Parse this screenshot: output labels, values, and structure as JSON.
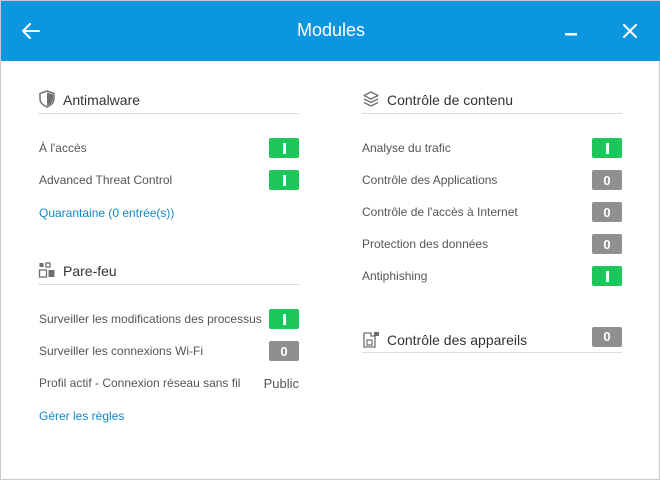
{
  "window": {
    "title": "Modules",
    "accent": "#0d96e0"
  },
  "colors": {
    "on": "#1ec55b",
    "off": "#8f8f8f",
    "link": "#1288c8"
  },
  "antimalware": {
    "title": "Antimalware",
    "icon": "shield-icon",
    "rows": [
      {
        "label": "À l'accès",
        "state": "on"
      },
      {
        "label": "Advanced Threat Control",
        "state": "on"
      }
    ],
    "quarantine_link": "Quarantaine (0 entrée(s))"
  },
  "firewall": {
    "title": "Pare-feu",
    "icon": "firewall-icon",
    "rows": [
      {
        "label": "Surveiller les modifications des processus",
        "state": "on"
      },
      {
        "label": "Surveiller les connexions Wi-Fi",
        "state": "off",
        "off_label": "0"
      }
    ],
    "profile_label": "Profil actif - Connexion réseau sans fil",
    "profile_value": "Public",
    "rules_link": "Gérer les règles"
  },
  "content_control": {
    "title": "Contrôle de contenu",
    "icon": "layers-icon",
    "rows": [
      {
        "label": "Analyse du trafic",
        "state": "on"
      },
      {
        "label": "Contrôle des Applications",
        "state": "off",
        "off_label": "0"
      },
      {
        "label": "Contrôle de l'accès à Internet",
        "state": "off",
        "off_label": "0"
      },
      {
        "label": "Protection des données",
        "state": "off",
        "off_label": "0"
      },
      {
        "label": "Antiphishing",
        "state": "on"
      }
    ]
  },
  "device_control": {
    "title": "Contrôle des appareils",
    "icon": "device-icon",
    "state": "off",
    "off_label": "0"
  }
}
